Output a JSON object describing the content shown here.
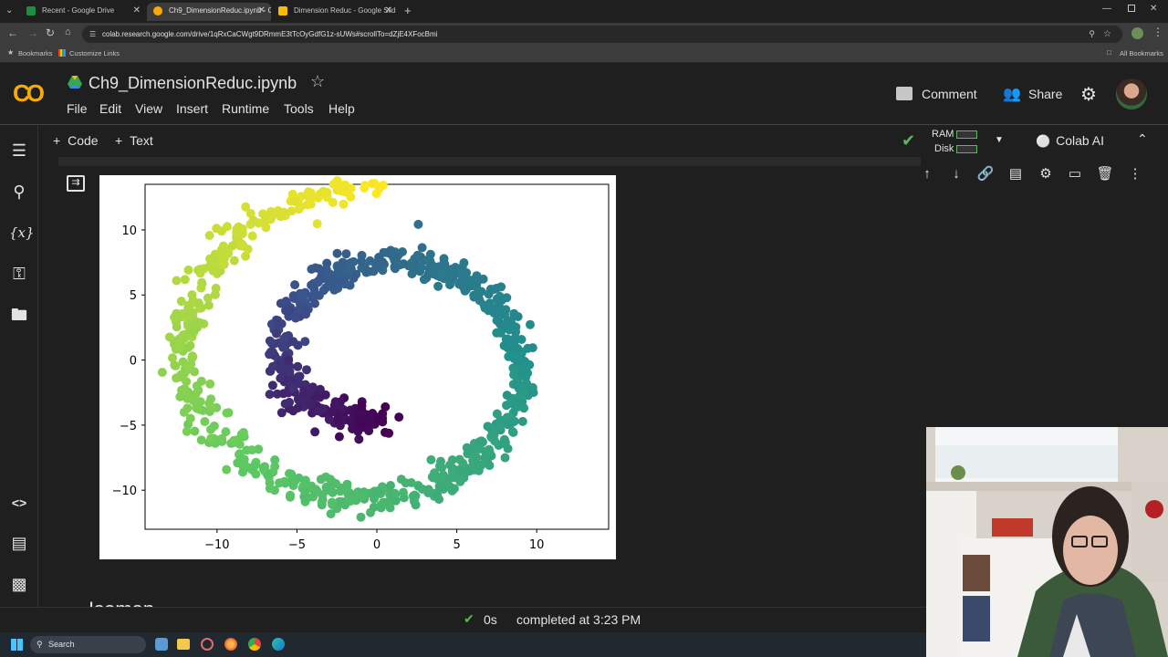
{
  "browser": {
    "tabs": [
      {
        "title": "Recent - Google Drive",
        "color": "#1e8e3e",
        "active": false
      },
      {
        "title": "Ch9_DimensionReduc.ipynb - C",
        "color": "#f9ab00",
        "active": true
      },
      {
        "title": "Dimension Reduc - Google Slid",
        "color": "#fbbc04",
        "active": false
      }
    ],
    "url": "colab.research.google.com/drive/1qRxCaCWgt9DRmmE3tTcOyGdfG1z-sUWs#scrollTo=dZjE4XFocBmi",
    "bookmarks_label": "Bookmarks",
    "customize_label": "Customize Links",
    "all_bookmarks_label": "All Bookmarks"
  },
  "colab": {
    "logo_text": "CO",
    "notebook_title": "Ch9_DimensionReduc.ipynb",
    "menu": [
      "File",
      "Edit",
      "View",
      "Insert",
      "Runtime",
      "Tools",
      "Help"
    ],
    "comment_label": "Comment",
    "share_label": "Share",
    "add_code_label": "Code",
    "add_text_label": "Text",
    "ram_label": "RAM",
    "disk_label": "Disk",
    "colab_ai_label": "Colab AI",
    "next_heading_partial": "Isomap"
  },
  "status": {
    "duration": "0s",
    "completed_text": "completed at 3:23 PM"
  },
  "taskbar": {
    "search_label": "Search"
  },
  "chart_data": {
    "type": "scatter",
    "title": "",
    "xlabel": "",
    "ylabel": "",
    "xlim": [
      -14.5,
      14.5
    ],
    "ylim": [
      -13,
      13.5
    ],
    "xticks": [
      -10,
      -5,
      0,
      5,
      10
    ],
    "yticks": [
      -10,
      -5,
      0,
      5,
      10
    ],
    "xtick_labels": [
      "−10",
      "−5",
      "0",
      "5",
      "10"
    ],
    "ytick_labels": [
      "−10",
      "−5",
      "0",
      "5",
      "10"
    ],
    "colormap": "viridis",
    "grid": false,
    "description_points": "Swiss roll 2D projection; points along a spiral colored by position (viridis)",
    "spiral": {
      "t_start": 4.712,
      "t_end": 14.137,
      "n_points": 1000,
      "noise": 0.6
    }
  }
}
